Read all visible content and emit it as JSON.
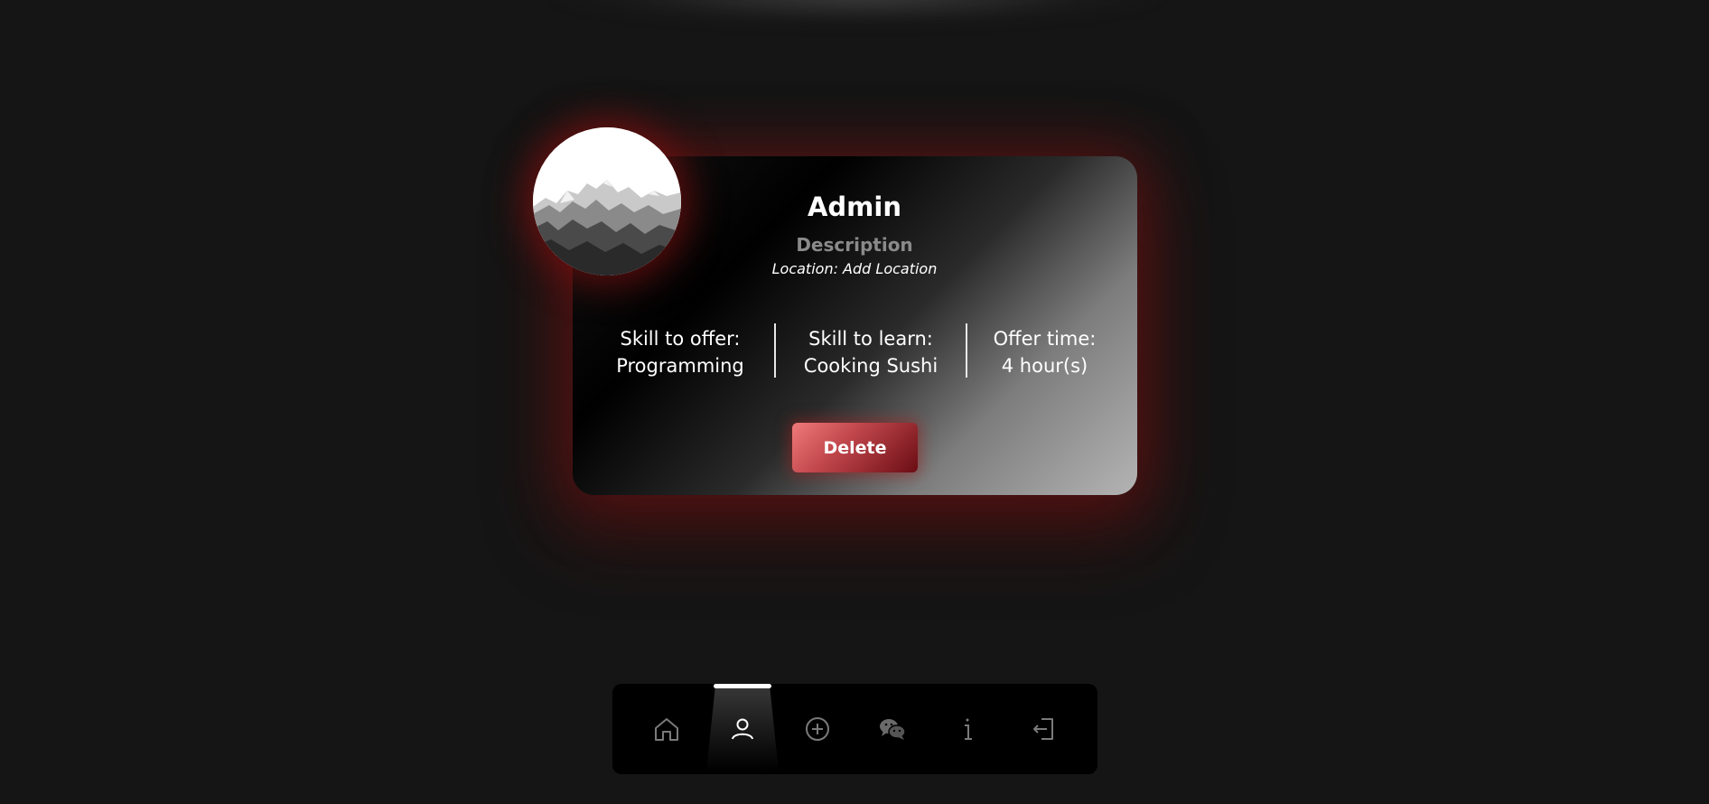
{
  "profile": {
    "name": "Admin",
    "description": "Description",
    "location": "Location: Add Location"
  },
  "stats": [
    {
      "label": "Skill to offer:",
      "value": "Programming"
    },
    {
      "label": "Skill to learn:",
      "value": "Cooking Sushi"
    },
    {
      "label": "Offer time:",
      "value": "4 hour(s)"
    }
  ],
  "actions": {
    "delete_label": "Delete"
  },
  "nav": {
    "active": "profile",
    "items": [
      {
        "icon": "home-icon"
      },
      {
        "icon": "user-icon"
      },
      {
        "icon": "add-circle-icon"
      },
      {
        "icon": "chat-icon"
      },
      {
        "icon": "info-icon"
      },
      {
        "icon": "logout-icon"
      }
    ]
  },
  "colors": {
    "background": "#151515",
    "accent_red": "#c1474c",
    "glow_red": "#6e1212",
    "muted_text": "#8a8a8a"
  }
}
